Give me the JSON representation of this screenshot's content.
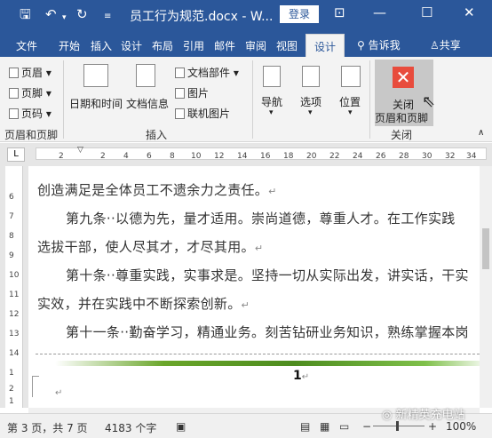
{
  "titlebar": {
    "title": "员工行为规范.docx - W...",
    "login": "登录",
    "icons": [
      "save-icon",
      "undo-icon",
      "redo-icon",
      "customize-icon"
    ]
  },
  "tabs": [
    "文件",
    "开始",
    "插入",
    "设计",
    "布局",
    "引用",
    "邮件",
    "审阅",
    "视图",
    "设计"
  ],
  "active_tab_index": 9,
  "tell_me": "告诉我",
  "share": "共享",
  "ribbon": {
    "hf_items": [
      "页眉",
      "页脚",
      "页码"
    ],
    "hf_group": "页眉和页脚",
    "date_time": "日期和时间",
    "doc_info": "文档信息",
    "doc_parts": "文档部件",
    "pictures": "图片",
    "online_pictures": "联机图片",
    "insert_group": "插入",
    "navigation": "导航",
    "options": "选项",
    "position": "位置",
    "close_line1": "关闭",
    "close_line2": "页眉和页脚",
    "close_group": "关闭"
  },
  "ruler": {
    "ticks": [
      "2",
      "2",
      "4",
      "6",
      "8",
      "10",
      "12",
      "14",
      "16",
      "18",
      "20",
      "22",
      "24",
      "26",
      "28",
      "30",
      "32",
      "34"
    ],
    "vticks": [
      "6",
      "7",
      "8",
      "9",
      "10",
      "11",
      "12",
      "13",
      "14",
      "1",
      "2",
      "1"
    ]
  },
  "document": {
    "lines": [
      "创造满足是全体员工不遗余力之责任。",
      "第九条··以德为先，量才适用。崇尚道德，尊重人才。在工作实践",
      "选拔干部，使人尽其才，才尽其用。",
      "第十条··尊重实践，实事求是。坚持一切从实际出发，讲实话，干实",
      "实效，并在实践中不断探索创新。",
      "第十一条··勤奋学习，精通业务。刻苦钻研业务知识，熟练掌握本岗"
    ],
    "footer_page_number": "1"
  },
  "status": {
    "page": "第 3 页，共 7 页",
    "words": "4183 个字",
    "zoom": "100%"
  },
  "watermark": "新精英充电站"
}
